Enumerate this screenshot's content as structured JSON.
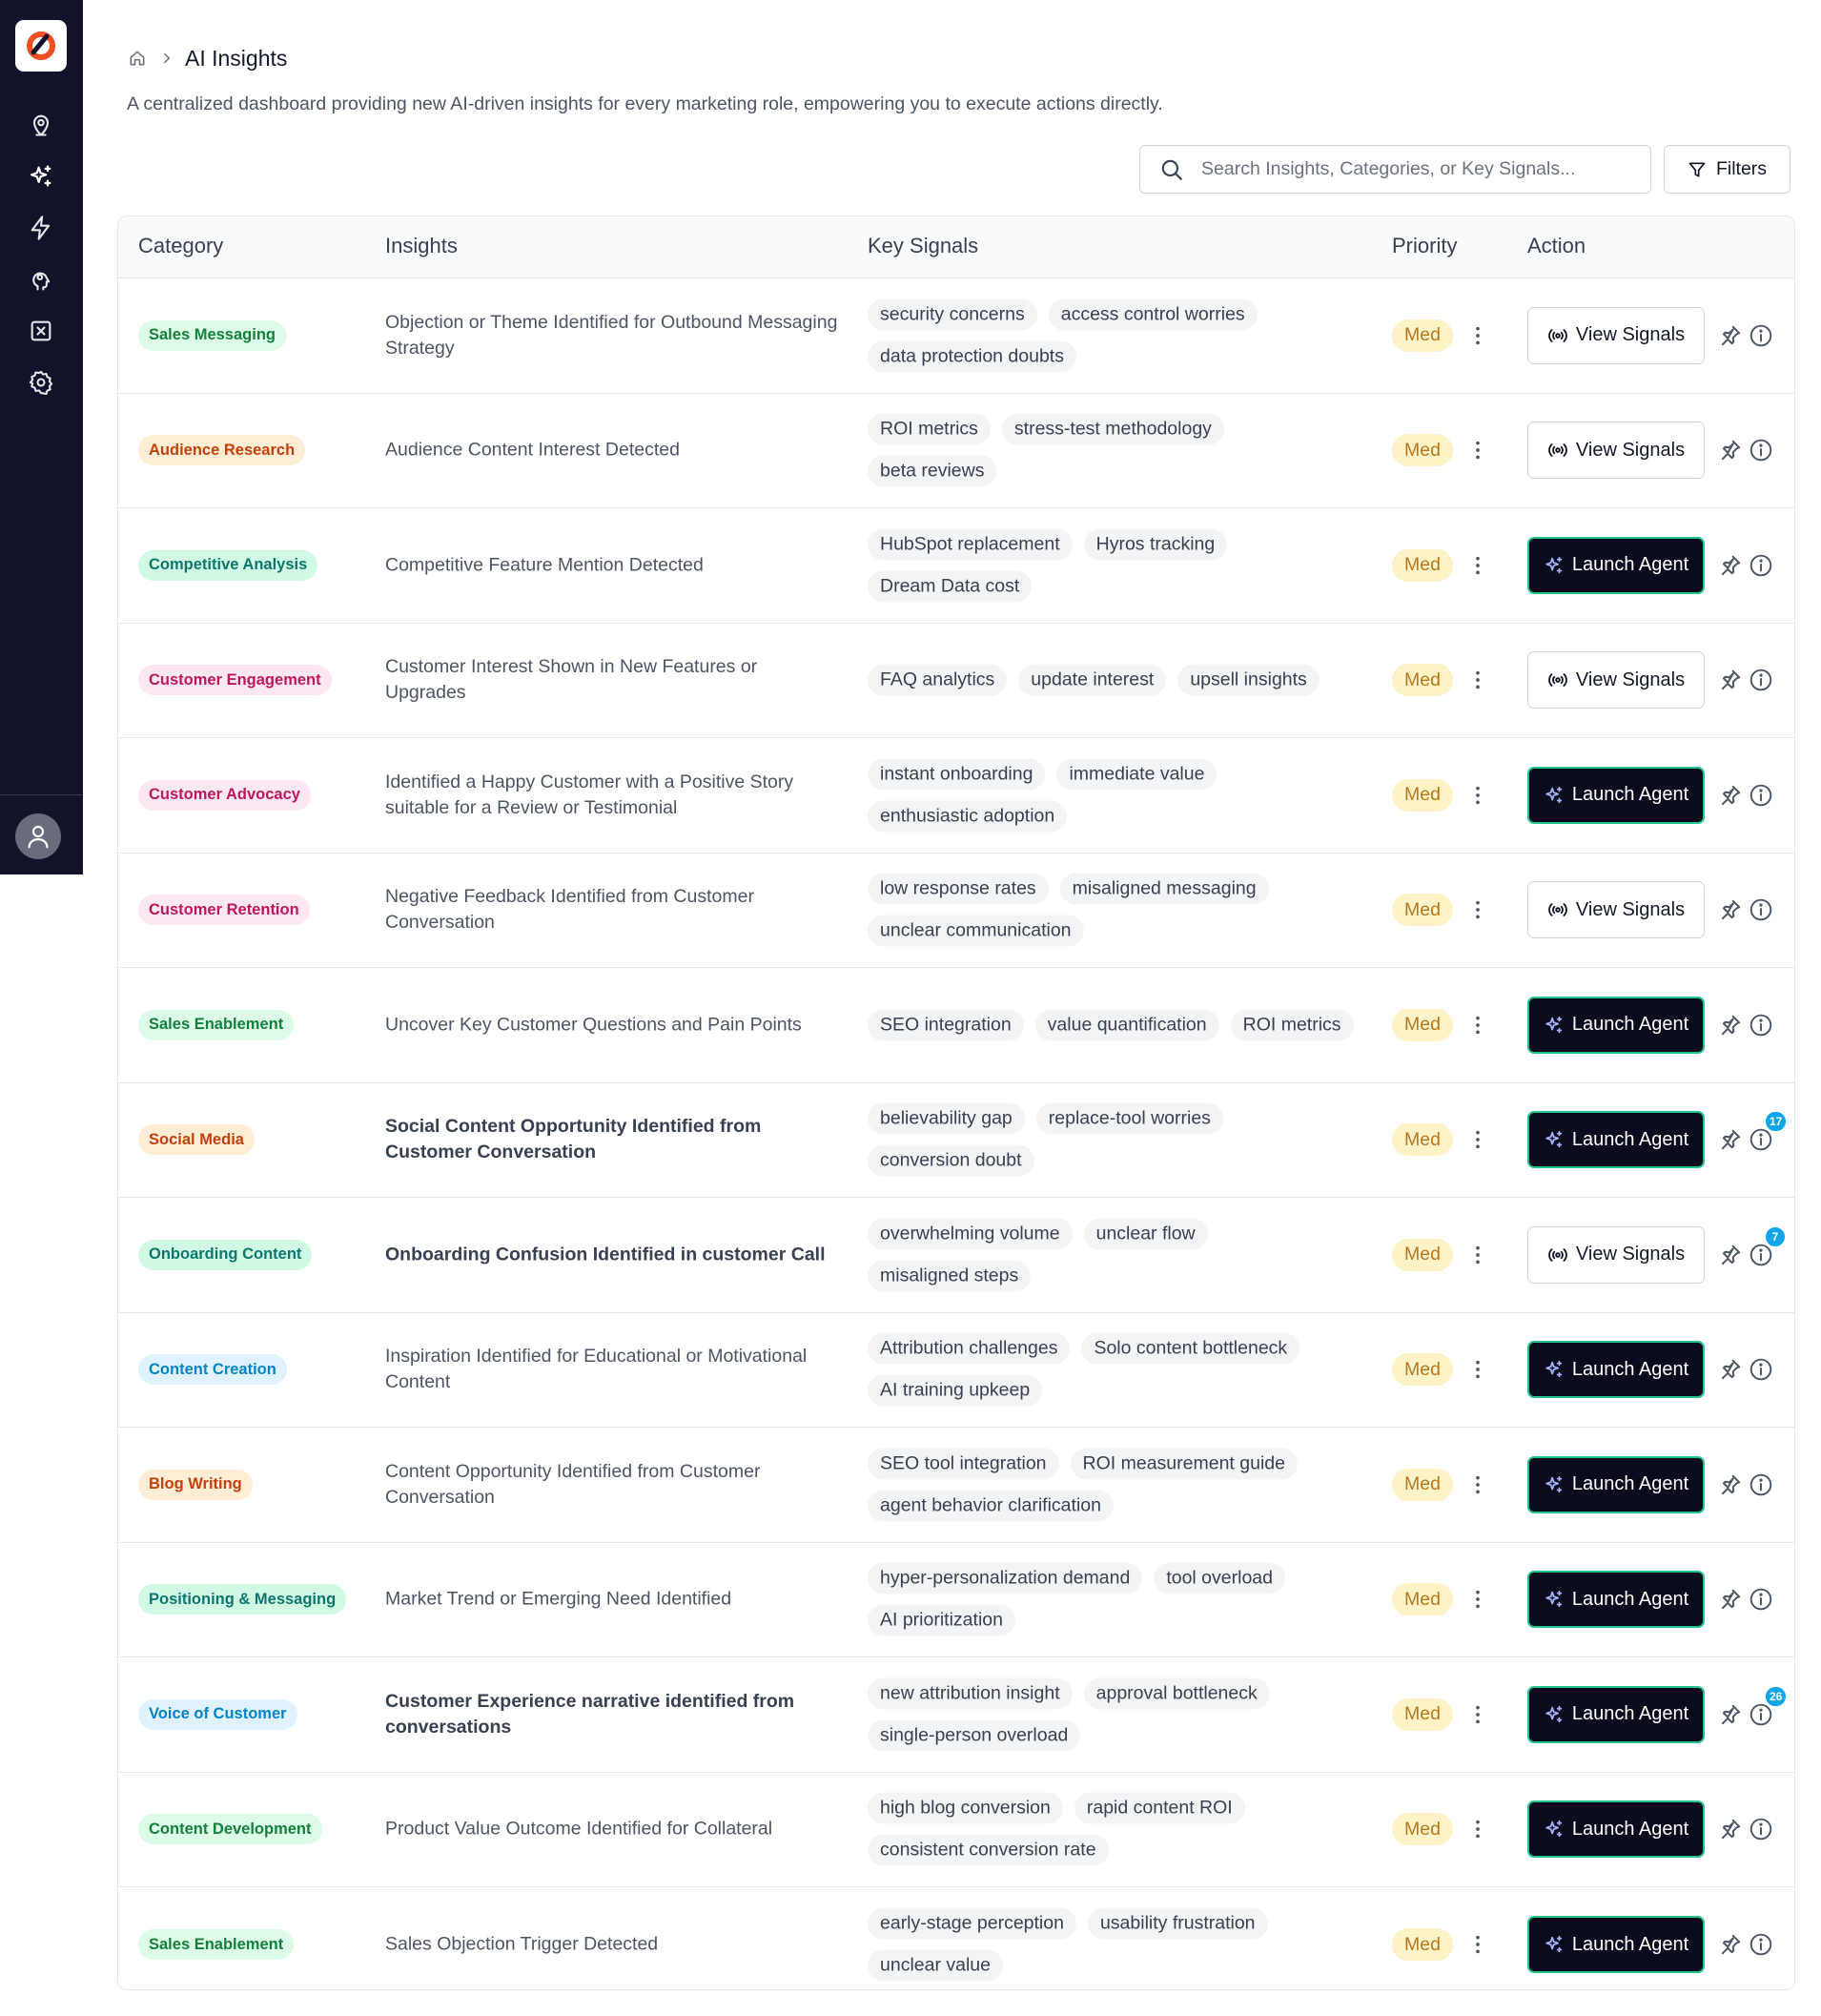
{
  "header": {
    "breadcrumb_title": "AI Insights",
    "description": "A centralized dashboard providing new AI-driven insights for every marketing role, empowering you to execute actions directly."
  },
  "search": {
    "placeholder": "Search Insights, Categories, or Key Signals...",
    "value": ""
  },
  "filters_label": "Filters",
  "sidebar": {
    "items": [
      "location-pin-icon",
      "sparkles-icon",
      "lightning-icon",
      "brain-gear-icon",
      "x-box-icon",
      "settings-gear-icon"
    ],
    "active_item": "sparkles-icon"
  },
  "table": {
    "columns": [
      "Category",
      "Insights",
      "Key Signals",
      "Priority",
      "Action"
    ],
    "rows": [
      {
        "category": "Sales Messaging",
        "cat_color": "green",
        "insight": "Objection or Theme Identified for Outbound Messaging Strategy",
        "bold": false,
        "signals": [
          "security concerns",
          "access control worries",
          "data protection doubts"
        ],
        "priority": "Med",
        "action": "View Signals",
        "badge": null
      },
      {
        "category": "Audience Research",
        "cat_color": "orange",
        "insight": "Audience Content Interest Detected",
        "bold": false,
        "signals": [
          "ROI metrics",
          "stress-test methodology",
          "beta reviews"
        ],
        "priority": "Med",
        "action": "View Signals",
        "badge": null
      },
      {
        "category": "Competitive Analysis",
        "cat_color": "teal",
        "insight": "Competitive Feature Mention Detected",
        "bold": false,
        "signals": [
          "HubSpot replacement",
          "Hyros tracking",
          "Dream Data cost"
        ],
        "priority": "Med",
        "action": "Launch Agent",
        "badge": null
      },
      {
        "category": "Customer Engagement",
        "cat_color": "pink",
        "insight": "Customer Interest Shown in New Features or Upgrades",
        "bold": false,
        "signals": [
          "FAQ analytics",
          "update interest",
          "upsell insights"
        ],
        "priority": "Med",
        "action": "View Signals",
        "badge": null
      },
      {
        "category": "Customer Advocacy",
        "cat_color": "pink",
        "insight": "Identified a Happy Customer with a Positive Story suitable for a Review or Testimonial",
        "bold": false,
        "signals": [
          "instant onboarding",
          "immediate value",
          "enthusiastic adoption"
        ],
        "priority": "Med",
        "action": "Launch Agent",
        "badge": null
      },
      {
        "category": "Customer Retention",
        "cat_color": "pink",
        "insight": "Negative Feedback Identified from Customer Conversation",
        "bold": false,
        "signals": [
          "low response rates",
          "misaligned messaging",
          "unclear communication"
        ],
        "priority": "Med",
        "action": "View Signals",
        "badge": null
      },
      {
        "category": "Sales Enablement",
        "cat_color": "green",
        "insight": "Uncover Key Customer Questions and Pain Points",
        "bold": false,
        "signals": [
          "SEO integration",
          "value quantification",
          "ROI metrics"
        ],
        "priority": "Med",
        "action": "Launch Agent",
        "badge": null
      },
      {
        "category": "Social Media",
        "cat_color": "orange",
        "insight": "Social Content Opportunity Identified from Customer Conversation",
        "bold": true,
        "signals": [
          "believability gap",
          "replace-tool worries",
          "conversion doubt"
        ],
        "priority": "Med",
        "action": "Launch Agent",
        "badge": "17"
      },
      {
        "category": "Onboarding Content",
        "cat_color": "teal",
        "insight": "Onboarding Confusion Identified in customer Call",
        "bold": true,
        "signals": [
          "overwhelming volume",
          "unclear flow",
          "misaligned steps"
        ],
        "priority": "Med",
        "action": "View Signals",
        "badge": "7"
      },
      {
        "category": "Content Creation",
        "cat_color": "blue",
        "insight": "Inspiration Identified for Educational or Motivational Content",
        "bold": false,
        "signals": [
          "Attribution challenges",
          "Solo content bottleneck",
          "AI training upkeep"
        ],
        "priority": "Med",
        "action": "Launch Agent",
        "badge": null
      },
      {
        "category": "Blog Writing",
        "cat_color": "orange",
        "insight": "Content Opportunity Identified from Customer Conversation",
        "bold": false,
        "signals": [
          "SEO tool integration",
          "ROI measurement guide",
          "agent behavior clarification"
        ],
        "priority": "Med",
        "action": "Launch Agent",
        "badge": null
      },
      {
        "category": "Positioning & Messaging",
        "cat_color": "teal",
        "insight": "Market Trend or Emerging Need Identified",
        "bold": false,
        "signals": [
          "hyper-personalization demand",
          "tool overload",
          "AI prioritization"
        ],
        "priority": "Med",
        "action": "Launch Agent",
        "badge": null
      },
      {
        "category": "Voice of Customer",
        "cat_color": "blue",
        "insight": "Customer Experience narrative identified from conversations",
        "bold": true,
        "signals": [
          "new attribution insight",
          "approval bottleneck",
          "single-person overload"
        ],
        "priority": "Med",
        "action": "Launch Agent",
        "badge": "26"
      },
      {
        "category": "Content Development",
        "cat_color": "green",
        "insight": "Product Value Outcome Identified for Collateral",
        "bold": false,
        "signals": [
          "high blog conversion",
          "rapid content ROI",
          "consistent conversion rate"
        ],
        "priority": "Med",
        "action": "Launch Agent",
        "badge": null
      },
      {
        "category": "Sales Enablement",
        "cat_color": "green",
        "insight": "Sales Objection Trigger Detected",
        "bold": false,
        "signals": [
          "early-stage perception",
          "usability frustration",
          "unclear value"
        ],
        "priority": "Med",
        "action": "Launch Agent",
        "badge": null
      }
    ]
  },
  "colors": {
    "sidebar_bg": "#12122a",
    "launch_border": "#22c58b",
    "priority_bg": "#fef3c7",
    "priority_text": "#b7791f",
    "badge": "#0ea5e9",
    "category": {
      "green": {
        "bg": "#dcfce7",
        "fg": "#15803d"
      },
      "orange": {
        "bg": "#ffedd5",
        "fg": "#c2410c"
      },
      "teal": {
        "bg": "#d1fae5",
        "fg": "#0f766e"
      },
      "pink": {
        "bg": "#fce7f3",
        "fg": "#be185d"
      },
      "blue": {
        "bg": "#e0f2fe",
        "fg": "#0284c7"
      }
    }
  }
}
